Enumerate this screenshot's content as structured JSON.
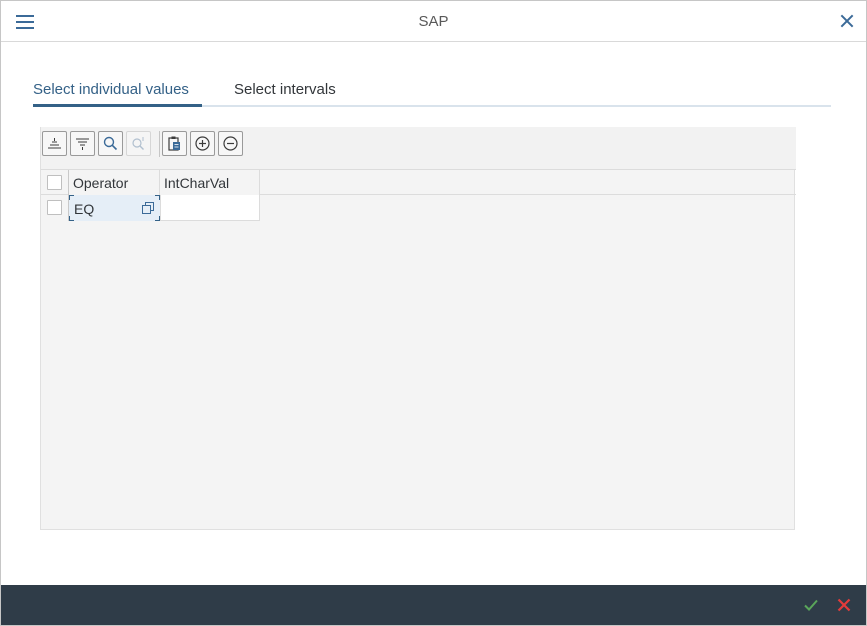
{
  "window": {
    "title": "SAP"
  },
  "tabs": [
    {
      "label": "Select individual values",
      "active": true
    },
    {
      "label": "Select intervals",
      "active": false
    }
  ],
  "toolbar": {
    "buttons": [
      {
        "icon": "sort-ascending-icon",
        "enabled": true
      },
      {
        "icon": "filter-icon",
        "enabled": true
      },
      {
        "icon": "search-icon",
        "enabled": true
      },
      {
        "icon": "search-next-icon",
        "enabled": false
      },
      {
        "icon": "paste-icon",
        "enabled": true
      },
      {
        "icon": "add-row-icon",
        "enabled": true
      },
      {
        "icon": "delete-row-icon",
        "enabled": true
      }
    ]
  },
  "table": {
    "columns": [
      "Operator",
      "IntCharVal"
    ],
    "rows": [
      {
        "operator": "EQ",
        "value": ""
      }
    ]
  },
  "colors": {
    "accent": "#346187",
    "footer": "#2f3c48",
    "ok": "#5aa65a",
    "cancel": "#e33b3b"
  }
}
